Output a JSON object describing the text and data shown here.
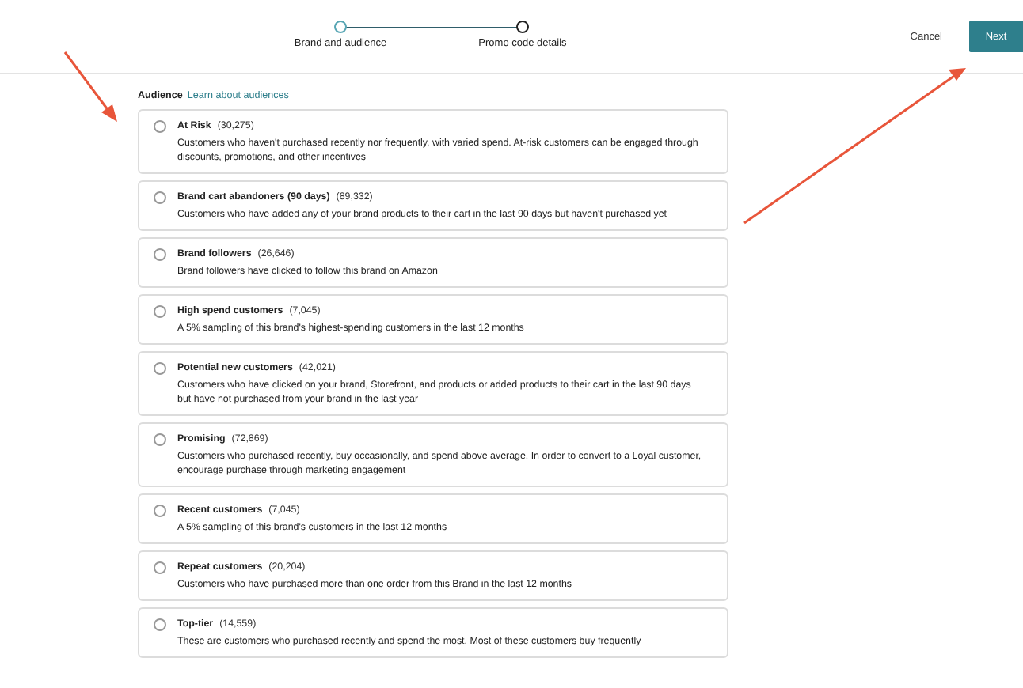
{
  "stepper": {
    "steps": [
      {
        "label": "Brand and audience",
        "selected": true
      },
      {
        "label": "Promo code details",
        "selected": false
      }
    ]
  },
  "actions": {
    "cancel": "Cancel",
    "next": "Next"
  },
  "audience": {
    "label": "Audience",
    "link": "Learn about audiences",
    "options": [
      {
        "name": "At Risk",
        "count": "(30,275)",
        "description": "Customers who haven't purchased recently nor frequently, with varied spend. At-risk customers can be engaged through discounts, promotions, and other incentives",
        "selected": false
      },
      {
        "name": "Brand cart abandoners (90 days)",
        "count": "(89,332)",
        "description": "Customers who have added any of your brand products to their cart in the last 90 days but haven't purchased yet",
        "selected": false
      },
      {
        "name": "Brand followers",
        "count": "(26,646)",
        "description": "Brand followers have clicked to follow this brand on Amazon",
        "selected": false
      },
      {
        "name": "High spend customers",
        "count": "(7,045)",
        "description": "A 5% sampling of this brand's highest-spending customers in the last 12 months",
        "selected": false
      },
      {
        "name": "Potential new customers",
        "count": "(42,021)",
        "description": "Customers who have clicked on your brand, Storefront, and products or added products to their cart in the last 90 days but have not purchased from your brand in the last year",
        "selected": false
      },
      {
        "name": "Promising",
        "count": "(72,869)",
        "description": "Customers who purchased recently, buy occasionally, and spend above average. In order to convert to a Loyal customer, encourage purchase through marketing engagement",
        "selected": false
      },
      {
        "name": "Recent customers",
        "count": "(7,045)",
        "description": "A 5% sampling of this brand's customers in the last 12 months",
        "selected": false
      },
      {
        "name": "Repeat customers",
        "count": "(20,204)",
        "description": "Customers who have purchased more than one order from this Brand in the last 12 months",
        "selected": false
      },
      {
        "name": "Top-tier",
        "count": "(14,559)",
        "description": "These are customers who purchased recently and spend the most. Most of these customers buy frequently",
        "selected": false
      }
    ]
  }
}
